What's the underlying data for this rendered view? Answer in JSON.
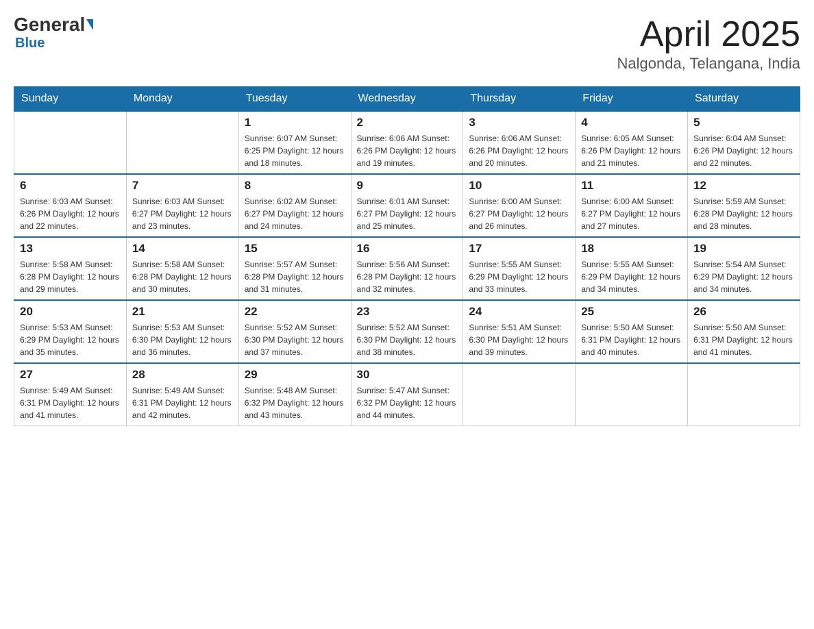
{
  "header": {
    "logo": {
      "general": "General",
      "blue": "Blue"
    },
    "title": "April 2025",
    "location": "Nalgonda, Telangana, India"
  },
  "calendar": {
    "days_of_week": [
      "Sunday",
      "Monday",
      "Tuesday",
      "Wednesday",
      "Thursday",
      "Friday",
      "Saturday"
    ],
    "weeks": [
      [
        {
          "day": "",
          "info": ""
        },
        {
          "day": "",
          "info": ""
        },
        {
          "day": "1",
          "info": "Sunrise: 6:07 AM\nSunset: 6:25 PM\nDaylight: 12 hours\nand 18 minutes."
        },
        {
          "day": "2",
          "info": "Sunrise: 6:06 AM\nSunset: 6:26 PM\nDaylight: 12 hours\nand 19 minutes."
        },
        {
          "day": "3",
          "info": "Sunrise: 6:06 AM\nSunset: 6:26 PM\nDaylight: 12 hours\nand 20 minutes."
        },
        {
          "day": "4",
          "info": "Sunrise: 6:05 AM\nSunset: 6:26 PM\nDaylight: 12 hours\nand 21 minutes."
        },
        {
          "day": "5",
          "info": "Sunrise: 6:04 AM\nSunset: 6:26 PM\nDaylight: 12 hours\nand 22 minutes."
        }
      ],
      [
        {
          "day": "6",
          "info": "Sunrise: 6:03 AM\nSunset: 6:26 PM\nDaylight: 12 hours\nand 22 minutes."
        },
        {
          "day": "7",
          "info": "Sunrise: 6:03 AM\nSunset: 6:27 PM\nDaylight: 12 hours\nand 23 minutes."
        },
        {
          "day": "8",
          "info": "Sunrise: 6:02 AM\nSunset: 6:27 PM\nDaylight: 12 hours\nand 24 minutes."
        },
        {
          "day": "9",
          "info": "Sunrise: 6:01 AM\nSunset: 6:27 PM\nDaylight: 12 hours\nand 25 minutes."
        },
        {
          "day": "10",
          "info": "Sunrise: 6:00 AM\nSunset: 6:27 PM\nDaylight: 12 hours\nand 26 minutes."
        },
        {
          "day": "11",
          "info": "Sunrise: 6:00 AM\nSunset: 6:27 PM\nDaylight: 12 hours\nand 27 minutes."
        },
        {
          "day": "12",
          "info": "Sunrise: 5:59 AM\nSunset: 6:28 PM\nDaylight: 12 hours\nand 28 minutes."
        }
      ],
      [
        {
          "day": "13",
          "info": "Sunrise: 5:58 AM\nSunset: 6:28 PM\nDaylight: 12 hours\nand 29 minutes."
        },
        {
          "day": "14",
          "info": "Sunrise: 5:58 AM\nSunset: 6:28 PM\nDaylight: 12 hours\nand 30 minutes."
        },
        {
          "day": "15",
          "info": "Sunrise: 5:57 AM\nSunset: 6:28 PM\nDaylight: 12 hours\nand 31 minutes."
        },
        {
          "day": "16",
          "info": "Sunrise: 5:56 AM\nSunset: 6:28 PM\nDaylight: 12 hours\nand 32 minutes."
        },
        {
          "day": "17",
          "info": "Sunrise: 5:55 AM\nSunset: 6:29 PM\nDaylight: 12 hours\nand 33 minutes."
        },
        {
          "day": "18",
          "info": "Sunrise: 5:55 AM\nSunset: 6:29 PM\nDaylight: 12 hours\nand 34 minutes."
        },
        {
          "day": "19",
          "info": "Sunrise: 5:54 AM\nSunset: 6:29 PM\nDaylight: 12 hours\nand 34 minutes."
        }
      ],
      [
        {
          "day": "20",
          "info": "Sunrise: 5:53 AM\nSunset: 6:29 PM\nDaylight: 12 hours\nand 35 minutes."
        },
        {
          "day": "21",
          "info": "Sunrise: 5:53 AM\nSunset: 6:30 PM\nDaylight: 12 hours\nand 36 minutes."
        },
        {
          "day": "22",
          "info": "Sunrise: 5:52 AM\nSunset: 6:30 PM\nDaylight: 12 hours\nand 37 minutes."
        },
        {
          "day": "23",
          "info": "Sunrise: 5:52 AM\nSunset: 6:30 PM\nDaylight: 12 hours\nand 38 minutes."
        },
        {
          "day": "24",
          "info": "Sunrise: 5:51 AM\nSunset: 6:30 PM\nDaylight: 12 hours\nand 39 minutes."
        },
        {
          "day": "25",
          "info": "Sunrise: 5:50 AM\nSunset: 6:31 PM\nDaylight: 12 hours\nand 40 minutes."
        },
        {
          "day": "26",
          "info": "Sunrise: 5:50 AM\nSunset: 6:31 PM\nDaylight: 12 hours\nand 41 minutes."
        }
      ],
      [
        {
          "day": "27",
          "info": "Sunrise: 5:49 AM\nSunset: 6:31 PM\nDaylight: 12 hours\nand 41 minutes."
        },
        {
          "day": "28",
          "info": "Sunrise: 5:49 AM\nSunset: 6:31 PM\nDaylight: 12 hours\nand 42 minutes."
        },
        {
          "day": "29",
          "info": "Sunrise: 5:48 AM\nSunset: 6:32 PM\nDaylight: 12 hours\nand 43 minutes."
        },
        {
          "day": "30",
          "info": "Sunrise: 5:47 AM\nSunset: 6:32 PM\nDaylight: 12 hours\nand 44 minutes."
        },
        {
          "day": "",
          "info": ""
        },
        {
          "day": "",
          "info": ""
        },
        {
          "day": "",
          "info": ""
        }
      ]
    ]
  }
}
